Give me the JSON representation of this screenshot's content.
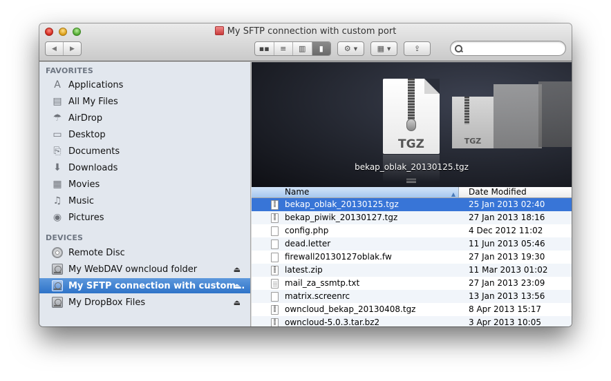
{
  "window": {
    "title": "My SFTP connection with custom port",
    "title_icon": "network-disk-icon"
  },
  "toolbar": {
    "back_glyph": "◀",
    "forward_glyph": "▶",
    "views": [
      {
        "name": "icon-view",
        "glyph": "▪▪",
        "active": false
      },
      {
        "name": "list-view",
        "glyph": "≡",
        "active": false
      },
      {
        "name": "column-view",
        "glyph": "▥",
        "active": false
      },
      {
        "name": "cover-flow-view",
        "glyph": "▮",
        "active": true
      }
    ],
    "action_glyph": "⚙",
    "arrange_glyph": "▦",
    "share_glyph": "⇪",
    "caret": "▼",
    "search": {
      "value": "",
      "placeholder": ""
    }
  },
  "sidebar": {
    "favorites_header": "FAVORITES",
    "favorites": [
      {
        "label": "Applications",
        "icon": "applications-icon",
        "glyph": "A"
      },
      {
        "label": "All My Files",
        "icon": "all-my-files-icon",
        "glyph": "▤"
      },
      {
        "label": "AirDrop",
        "icon": "airdrop-icon",
        "glyph": "☂"
      },
      {
        "label": "Desktop",
        "icon": "desktop-icon",
        "glyph": "▭"
      },
      {
        "label": "Documents",
        "icon": "documents-icon",
        "glyph": "⎘"
      },
      {
        "label": "Downloads",
        "icon": "downloads-icon",
        "glyph": "⬇"
      },
      {
        "label": "Movies",
        "icon": "movies-icon",
        "glyph": "▦"
      },
      {
        "label": "Music",
        "icon": "music-icon",
        "glyph": "♫"
      },
      {
        "label": "Pictures",
        "icon": "pictures-icon",
        "glyph": "◉"
      }
    ],
    "devices_header": "DEVICES",
    "devices": [
      {
        "label": "Remote Disc",
        "icon": "remote-disc-icon",
        "eject": false,
        "selected": false
      },
      {
        "label": "My WebDAV owncloud folder",
        "icon": "network-disk-icon",
        "eject": true,
        "selected": false
      },
      {
        "label": "My SFTP connection with custom…",
        "icon": "network-disk-icon",
        "eject": true,
        "selected": true
      },
      {
        "label": "My DropBox Files",
        "icon": "network-disk-icon",
        "eject": true,
        "selected": false
      }
    ],
    "eject_glyph": "⏏"
  },
  "coverflow": {
    "caption": "bekap_oblak_20130125.tgz",
    "main_label": "TGZ",
    "side_label": "TGZ"
  },
  "list": {
    "columns": {
      "name": "Name",
      "date": "Date Modified",
      "sort_glyph": "▲"
    },
    "rows": [
      {
        "name": "bekap_oblak_20130125.tgz",
        "date": "25 Jan 2013 02:40",
        "type": "zip",
        "selected": true
      },
      {
        "name": "bekap_piwik_20130127.tgz",
        "date": "27 Jan 2013 18:16",
        "type": "zip",
        "selected": false
      },
      {
        "name": "config.php",
        "date": "4 Dec 2012 11:02",
        "type": "doc",
        "selected": false
      },
      {
        "name": "dead.letter",
        "date": "11 Jun 2013 05:46",
        "type": "doc",
        "selected": false
      },
      {
        "name": "firewall20130127oblak.fw",
        "date": "27 Jan 2013 19:30",
        "type": "doc",
        "selected": false
      },
      {
        "name": "latest.zip",
        "date": "11 Mar 2013 01:02",
        "type": "zip",
        "selected": false
      },
      {
        "name": "mail_za_ssmtp.txt",
        "date": "27 Jan 2013 23:09",
        "type": "txt",
        "selected": false
      },
      {
        "name": "matrix.screenrc",
        "date": "13 Jan 2013 13:56",
        "type": "doc",
        "selected": false
      },
      {
        "name": "owncloud_bekap_20130408.tgz",
        "date": "8 Apr 2013 15:17",
        "type": "zip",
        "selected": false
      },
      {
        "name": "owncloud-5.0.3.tar.bz2",
        "date": "3 Apr 2013 10:05",
        "type": "zip",
        "selected": false
      }
    ]
  },
  "colors": {
    "selection": "#3875d7",
    "sidebar_bg": "#e2e7ee",
    "sidebar_selected": "#2e73c8"
  }
}
